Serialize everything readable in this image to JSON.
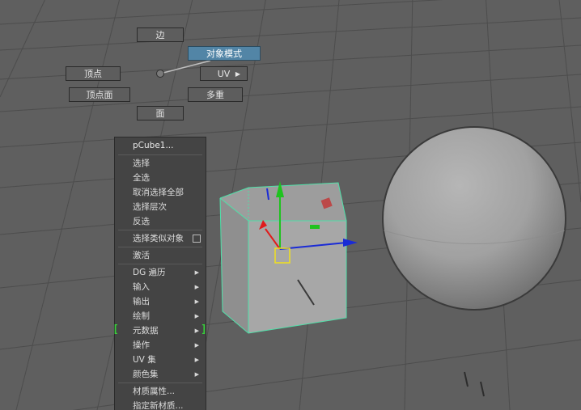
{
  "marking_menu": {
    "edge": "边",
    "object_mode": "对象模式",
    "vertex": "顶点",
    "uv": "UV",
    "vertex_face": "顶点面",
    "multi": "多重",
    "face": "面"
  },
  "context_menu": {
    "title": "pCube1...",
    "items": [
      {
        "label": "选择"
      },
      {
        "label": "全选"
      },
      {
        "label": "取消选择全部"
      },
      {
        "label": "选择层次"
      },
      {
        "label": "反选"
      },
      {
        "label": "选择类似对象"
      },
      {
        "label": "激活"
      },
      {
        "label": "DG 遍历"
      },
      {
        "label": "输入"
      },
      {
        "label": "输出"
      },
      {
        "label": "绘制"
      },
      {
        "label": "元数据"
      },
      {
        "label": "操作"
      },
      {
        "label": "UV 集"
      },
      {
        "label": "颜色集"
      },
      {
        "label": "材质属性..."
      },
      {
        "label": "指定新材质..."
      }
    ]
  },
  "colors": {
    "viewport_bg": "#5f5f5f",
    "grid_line": "#4a4a4a",
    "selection_wireframe": "#4fe0a8",
    "object_mode_highlight": "#5285a6",
    "axis_x": "#1a2bd6",
    "axis_y": "#1fc31f",
    "axis_z": "#e01c1c",
    "pivot": "#f0e01e",
    "bracket": "#37d23a"
  }
}
